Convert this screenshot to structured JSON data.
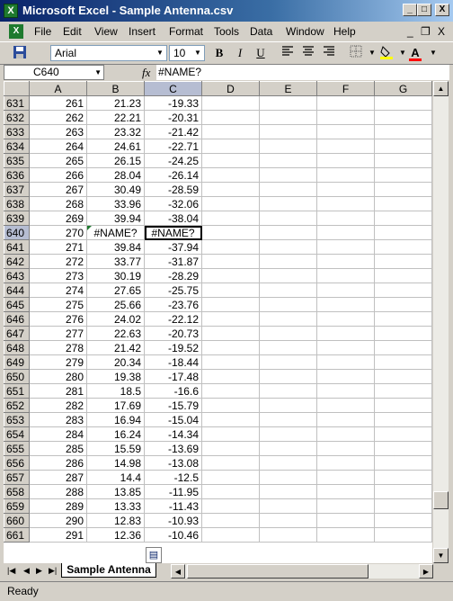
{
  "window": {
    "title": "Microsoft Excel - Sample Antenna.csv",
    "minimize": "_",
    "maximize": "□",
    "close": "X"
  },
  "menu": {
    "items": [
      "File",
      "Edit",
      "View",
      "Insert",
      "Format",
      "Tools",
      "Data",
      "Window",
      "Help"
    ],
    "mdi_minimize": "_",
    "mdi_restore": "❐",
    "mdi_close": "X"
  },
  "toolbar": {
    "font_name": "Arial",
    "font_size": "10",
    "bold": "B",
    "italic": "I",
    "underline": "U",
    "font_color_label": "A"
  },
  "formula_bar": {
    "name_box": "C640",
    "fx_label": "fx",
    "formula": "#NAME?"
  },
  "sheet": {
    "columns": [
      "A",
      "B",
      "C",
      "D",
      "E",
      "F",
      "G"
    ],
    "selected_column": "C",
    "active_cell": "C640",
    "rows": [
      {
        "n": "631",
        "a": "261",
        "b": "21.23",
        "c": "-19.33"
      },
      {
        "n": "632",
        "a": "262",
        "b": "22.21",
        "c": "-20.31"
      },
      {
        "n": "633",
        "a": "263",
        "b": "23.32",
        "c": "-21.42"
      },
      {
        "n": "634",
        "a": "264",
        "b": "24.61",
        "c": "-22.71"
      },
      {
        "n": "635",
        "a": "265",
        "b": "26.15",
        "c": "-24.25"
      },
      {
        "n": "636",
        "a": "266",
        "b": "28.04",
        "c": "-26.14"
      },
      {
        "n": "637",
        "a": "267",
        "b": "30.49",
        "c": "-28.59"
      },
      {
        "n": "638",
        "a": "268",
        "b": "33.96",
        "c": "-32.06"
      },
      {
        "n": "639",
        "a": "269",
        "b": "39.94",
        "c": "-38.04"
      },
      {
        "n": "640",
        "a": "270",
        "b": "#NAME?",
        "c": "#NAME?"
      },
      {
        "n": "641",
        "a": "271",
        "b": "39.84",
        "c": "-37.94"
      },
      {
        "n": "642",
        "a": "272",
        "b": "33.77",
        "c": "-31.87"
      },
      {
        "n": "643",
        "a": "273",
        "b": "30.19",
        "c": "-28.29"
      },
      {
        "n": "644",
        "a": "274",
        "b": "27.65",
        "c": "-25.75"
      },
      {
        "n": "645",
        "a": "275",
        "b": "25.66",
        "c": "-23.76"
      },
      {
        "n": "646",
        "a": "276",
        "b": "24.02",
        "c": "-22.12"
      },
      {
        "n": "647",
        "a": "277",
        "b": "22.63",
        "c": "-20.73"
      },
      {
        "n": "648",
        "a": "278",
        "b": "21.42",
        "c": "-19.52"
      },
      {
        "n": "649",
        "a": "279",
        "b": "20.34",
        "c": "-18.44"
      },
      {
        "n": "650",
        "a": "280",
        "b": "19.38",
        "c": "-17.48"
      },
      {
        "n": "651",
        "a": "281",
        "b": "18.5",
        "c": "-16.6"
      },
      {
        "n": "652",
        "a": "282",
        "b": "17.69",
        "c": "-15.79"
      },
      {
        "n": "653",
        "a": "283",
        "b": "16.94",
        "c": "-15.04"
      },
      {
        "n": "654",
        "a": "284",
        "b": "16.24",
        "c": "-14.34"
      },
      {
        "n": "655",
        "a": "285",
        "b": "15.59",
        "c": "-13.69"
      },
      {
        "n": "656",
        "a": "286",
        "b": "14.98",
        "c": "-13.08"
      },
      {
        "n": "657",
        "a": "287",
        "b": "14.4",
        "c": "-12.5"
      },
      {
        "n": "658",
        "a": "288",
        "b": "13.85",
        "c": "-11.95"
      },
      {
        "n": "659",
        "a": "289",
        "b": "13.33",
        "c": "-11.43"
      },
      {
        "n": "660",
        "a": "290",
        "b": "12.83",
        "c": "-10.93"
      },
      {
        "n": "661",
        "a": "291",
        "b": "12.36",
        "c": "-10.46"
      }
    ]
  },
  "sheet_tabs": {
    "nav": [
      "|◀",
      "◀",
      "▶",
      "▶|"
    ],
    "active_tab": "Sample Antenna"
  },
  "status": {
    "text": "Ready"
  },
  "colors": {
    "title_gradient_start": "#0a246a",
    "chrome": "#d4d0c8",
    "selected_header": "#b6bdd2",
    "error_indicator": "#1e7a2e",
    "font_color": "#ff0000",
    "fill_color": "#ffff00"
  }
}
